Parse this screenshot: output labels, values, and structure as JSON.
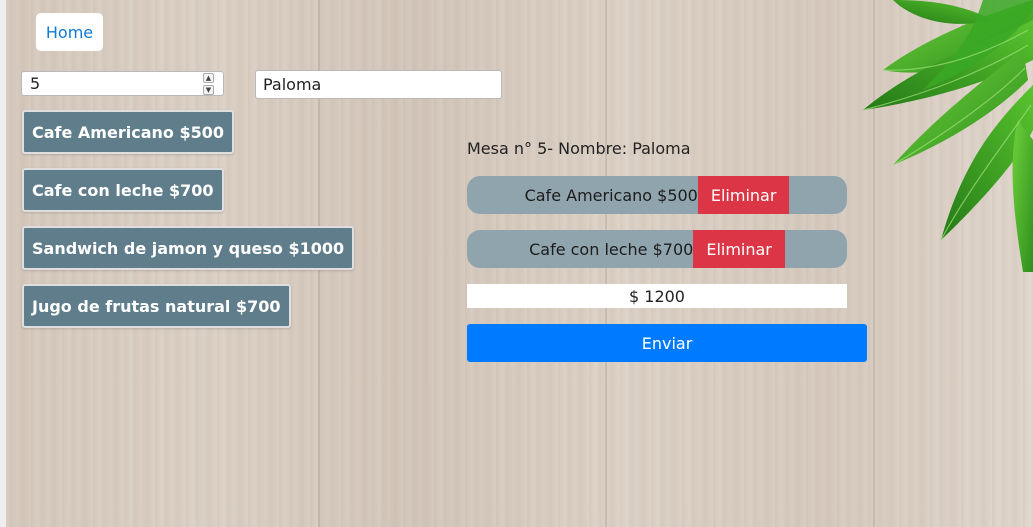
{
  "nav": {
    "home_label": "Home"
  },
  "form": {
    "table_number_value": "5",
    "name_value": "Paloma"
  },
  "products": [
    {
      "label": "Cafe Americano $500"
    },
    {
      "label": "Cafe con leche $700"
    },
    {
      "label": "Sandwich de jamon y queso $1000"
    },
    {
      "label": "Jugo de frutas natural $700"
    }
  ],
  "order": {
    "heading": "Mesa n° 5- Nombre: Paloma",
    "items": [
      {
        "label": "Cafe Americano $500",
        "remove_label": "Eliminar"
      },
      {
        "label": "Cafe con leche $700",
        "remove_label": "Eliminar"
      }
    ],
    "total": "$ 1200",
    "send_label": "Enviar"
  },
  "colors": {
    "product_button": "#607d8b",
    "order_item": "#90a4ae",
    "remove_button": "#dc3545",
    "send_button": "#007bff",
    "home_link": "#0f7ad3"
  },
  "icons": {
    "spinner_up": "chevron-up-icon",
    "spinner_down": "chevron-down-icon",
    "decoration": "leaves-decoration"
  }
}
